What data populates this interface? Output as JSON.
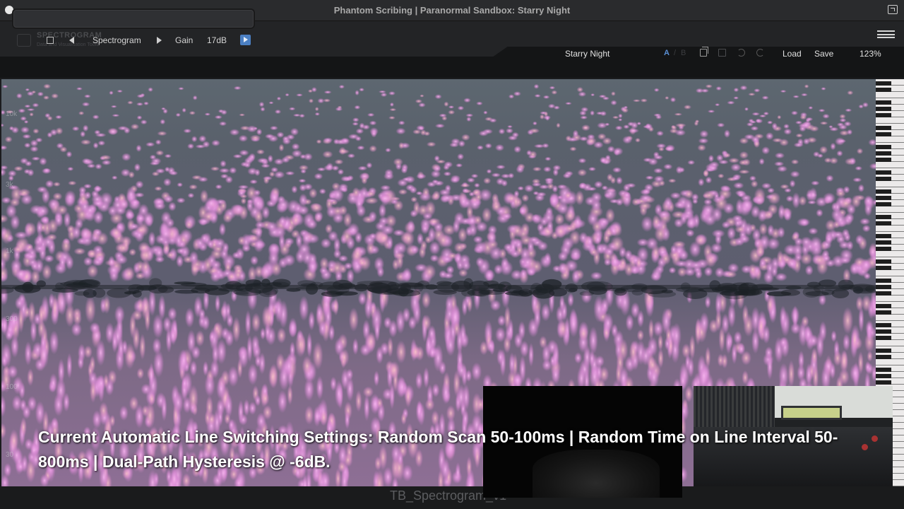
{
  "window": {
    "title": "Phantom Scribing | Paranormal Sandbox: Starry Night"
  },
  "toolbar": {
    "logo_text": "SPECTROGRAM",
    "logo_sub": "Data and Visualisation Tools",
    "view_mode": "Spectrogram",
    "gain_label": "Gain",
    "gain_value": "17dB",
    "preset_name": "Starry Night",
    "compare_a": "A",
    "compare_sep": "/",
    "compare_b": "B",
    "load_label": "Load",
    "save_label": "Save",
    "zoom": "123%"
  },
  "spectrogram": {
    "freq_labels": [
      "10k",
      "3k",
      "1k",
      "300",
      "100",
      "30"
    ]
  },
  "caption": {
    "text": "Current Automatic Line Switching Settings: Random Scan 50-100ms | Random Time on Line Interval 50-800ms | Dual-Path Hysteresis @ -6dB."
  },
  "footer": {
    "label": "TB_Spectrogram_v1"
  },
  "colors": {
    "accent": "#4b7fc2",
    "spectro_pink": "#e79be0",
    "spectro_bg": "#5f6973"
  }
}
